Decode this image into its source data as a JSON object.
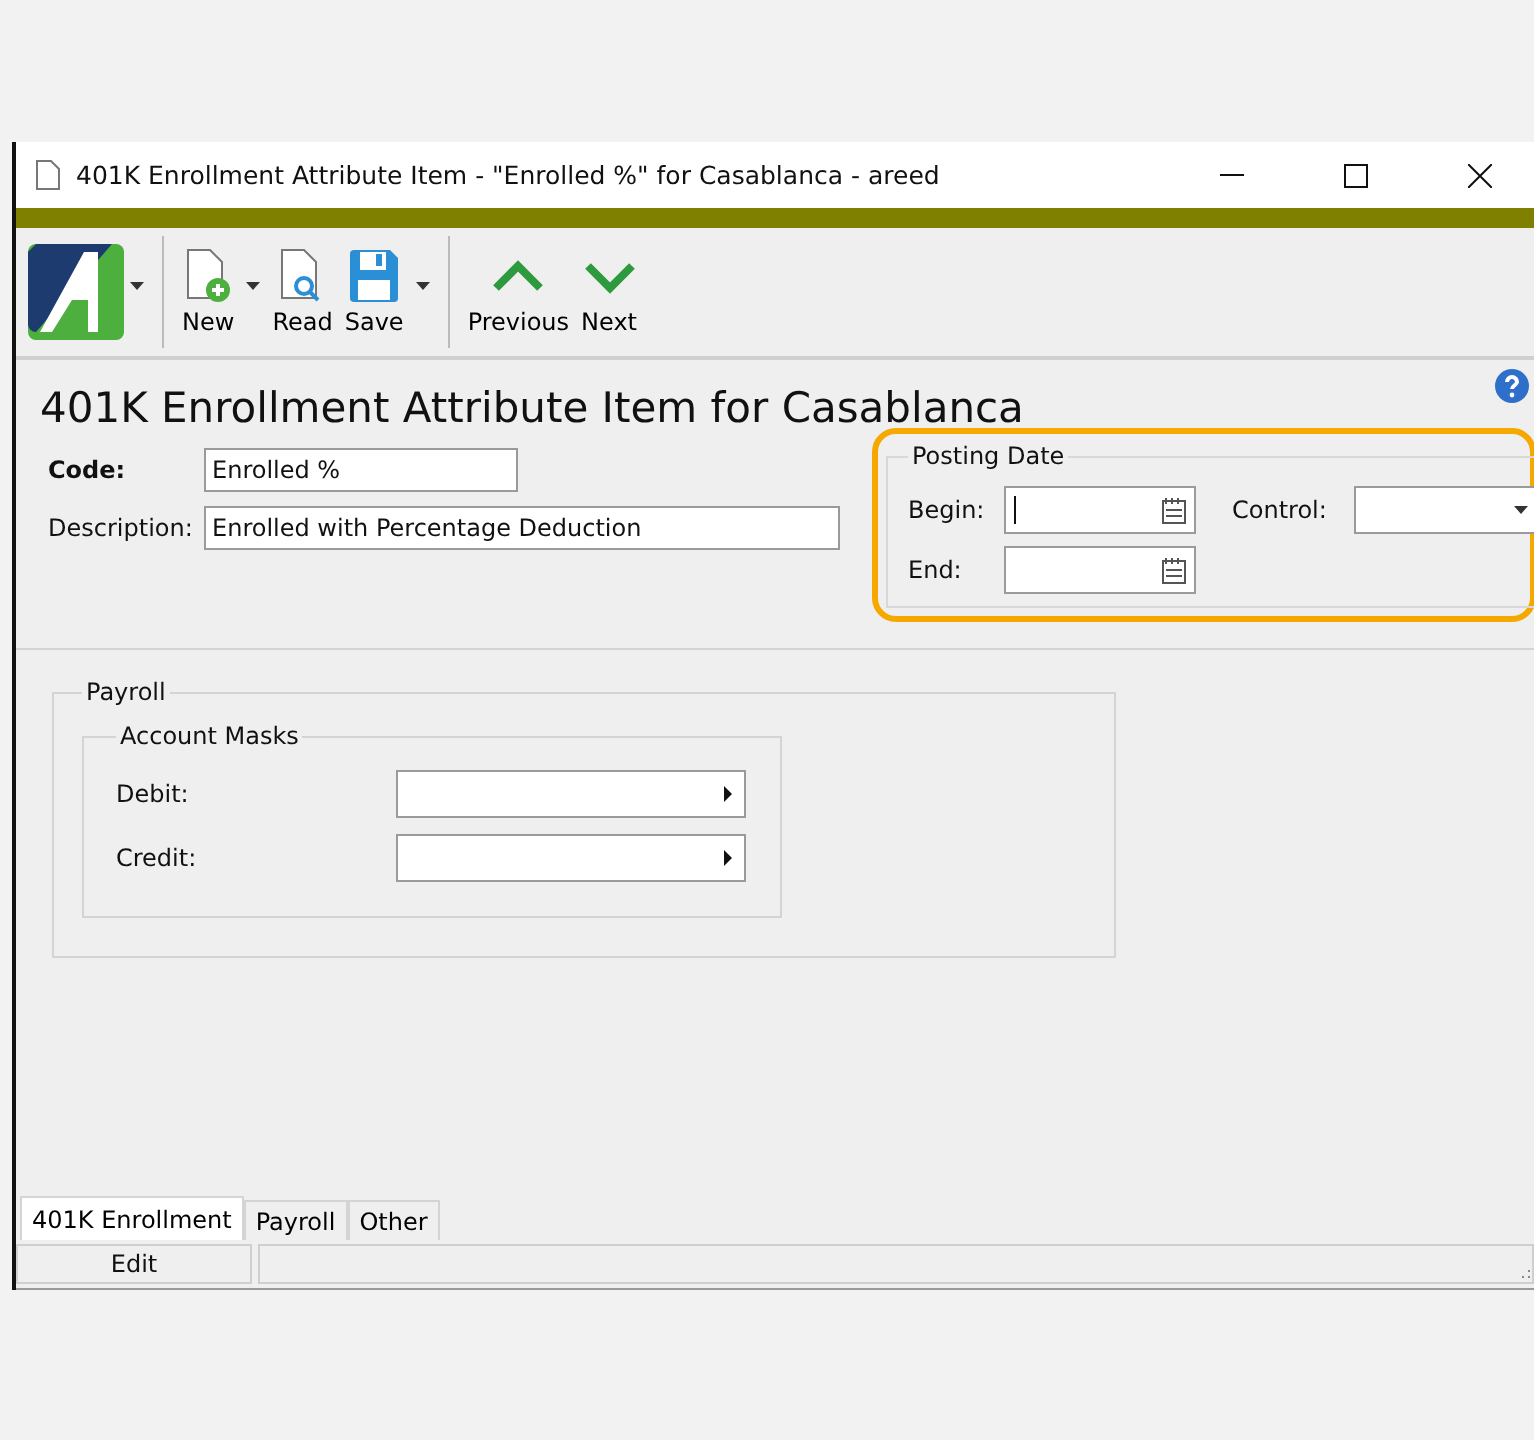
{
  "window": {
    "title": "401K Enrollment Attribute Item - \"Enrolled %\" for Casablanca - areed"
  },
  "toolbar": {
    "logo_dropdown": true,
    "items": [
      {
        "kind": "new",
        "label": "New",
        "dropdown": true
      },
      {
        "kind": "read",
        "label": "Read",
        "dropdown": false
      },
      {
        "kind": "save",
        "label": "Save",
        "dropdown": true
      },
      {
        "kind": "previous",
        "label": "Previous",
        "dropdown": false
      },
      {
        "kind": "next",
        "label": "Next",
        "dropdown": false
      }
    ]
  },
  "heading": "401K Enrollment Attribute Item for Casablanca",
  "fields": [
    {
      "label": "Code:",
      "value": "Enrolled %",
      "wide": false
    },
    {
      "label": "Description:",
      "value": "Enrolled with Percentage Deduction",
      "wide": true
    }
  ],
  "posting_date": {
    "title": "Posting Date",
    "highlighted": true,
    "begin": {
      "label": "Begin:",
      "focused": true
    },
    "end": {
      "label": "End:",
      "focused": false
    },
    "control": {
      "label": "Control:"
    }
  },
  "payroll": {
    "title": "Payroll",
    "account_masks": {
      "title": "Account Masks",
      "rows": [
        {
          "label": "Debit:"
        },
        {
          "label": "Credit:"
        }
      ]
    }
  },
  "tabs": [
    {
      "label": "401K Enrollment",
      "selected": true
    },
    {
      "label": "Payroll",
      "selected": false
    },
    {
      "label": "Other",
      "selected": false
    }
  ],
  "status_bar": {
    "mode": "Edit"
  }
}
